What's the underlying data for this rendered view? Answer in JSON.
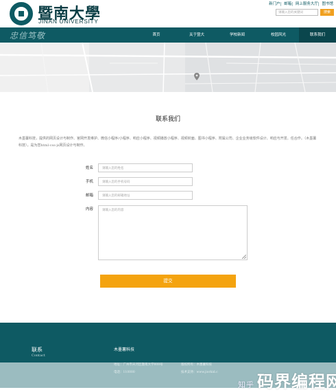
{
  "header": {
    "logo_cn": "暨南大學",
    "logo_en": "JINAN UNIVERSITY",
    "top_links": [
      "新门户",
      "邮箱",
      "网上服务大厅",
      "图书馆"
    ],
    "search_placeholder": "请输入您的关键词",
    "search_button": "搜索"
  },
  "nav": {
    "slogan": "忠信笃敬",
    "items": [
      "首页",
      "关于暨大",
      "学校新闻",
      "校园风光",
      "联系我们"
    ]
  },
  "contact": {
    "title": "联系我们",
    "intro": "木墨薯科技，提供的网页设计与制作、官网开发维护、微信小程序/小程序、响应小程序、视频播放小程序、视频封面、图书小程序、附属公司、企业业务级软件设计、响应与开发、任合作。（木墨薯科技），是为您html-css-js网页设计与制作。"
  },
  "form": {
    "name_label": "姓名",
    "name_placeholder": "请输入您的姓名",
    "phone_label": "手机",
    "phone_placeholder": "请输入您的手机号码",
    "email_label": "邮箱",
    "email_placeholder": "请输入您的邮箱地址",
    "content_label": "内容",
    "content_placeholder": "请输入您的内容",
    "submit_label": "提交"
  },
  "footer": {
    "title": "联系",
    "subtitle": "Contact",
    "company": "木墨薯科技",
    "address": "地址：广州市天河区暨南大学808号",
    "phone": "电话：110000",
    "copyright": "版权所有：木墨薯科技",
    "site": "技术支持：www.jiorkid.c"
  },
  "watermark": {
    "prefix": "知乎",
    "text": "码界编程网"
  }
}
